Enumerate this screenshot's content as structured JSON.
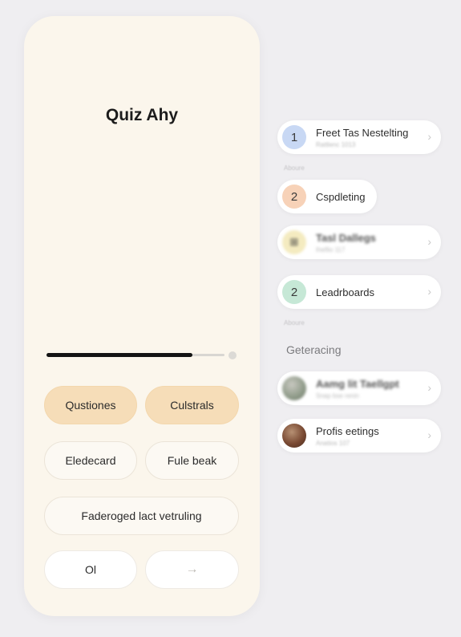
{
  "quiz": {
    "title": "Quiz Ahy",
    "progress": 0.82
  },
  "buttons": {
    "questions": "Qustiones",
    "cultstrals": "Culstrals",
    "elecard": "Eledecard",
    "fule_beak": "Fule beak",
    "wide": "Faderoged lact vetruling",
    "ok": "Ol",
    "next_icon": "arrow-right-icon"
  },
  "menu": {
    "items": [
      {
        "badge": "1",
        "label": "Freet Tas Nestelting",
        "sub": "Rattlenc 1013",
        "color": "#c8d8f4"
      },
      {
        "badge": "2",
        "label": "Cspdleting",
        "sub": "",
        "color": "#f7d2b8"
      },
      {
        "badge": "⊞",
        "label": "Tasl Dallegs",
        "sub": "Iheflio 117",
        "color": "#f4ebc0"
      },
      {
        "badge": "2",
        "label": "Leadrboards",
        "sub": "",
        "color": "#c6e8d6"
      },
      {
        "badge": "",
        "label": "Aamg lit Taellgpt",
        "sub": "Snap bse renin",
        "color": ""
      },
      {
        "badge": "",
        "label": "Profis eetings",
        "sub": "Anatios 107",
        "color": ""
      }
    ],
    "section_1": "Aboure",
    "section_2": "Aboure",
    "heading": "Geteracing"
  }
}
